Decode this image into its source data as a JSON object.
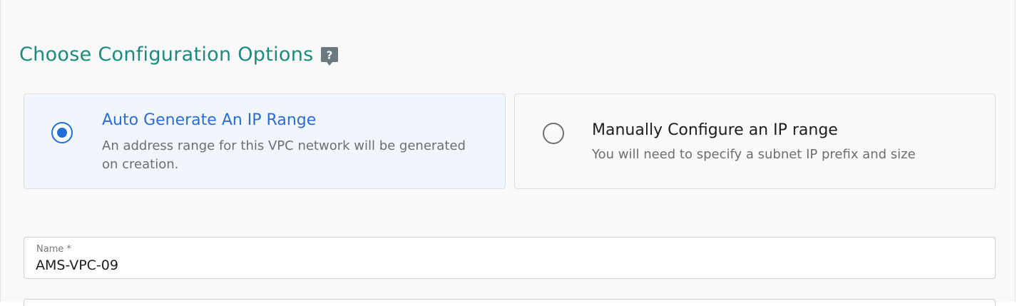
{
  "section": {
    "title": "Choose Configuration Options",
    "help_icon": "help-question-icon"
  },
  "options": [
    {
      "title": "Auto Generate An IP Range",
      "description": "An address range for this VPC network will be generated on creation.",
      "selected": true
    },
    {
      "title": "Manually Configure an IP range",
      "description": "You will need to specify a subnet IP prefix and size",
      "selected": false
    }
  ],
  "name_field": {
    "label": "Name *",
    "value": "AMS-VPC-09"
  },
  "colors": {
    "title": "#1b8a7f",
    "accent": "#1f6fd9",
    "selected_card_bg": "#f1f6fd",
    "help_icon": "#6b7a80"
  }
}
